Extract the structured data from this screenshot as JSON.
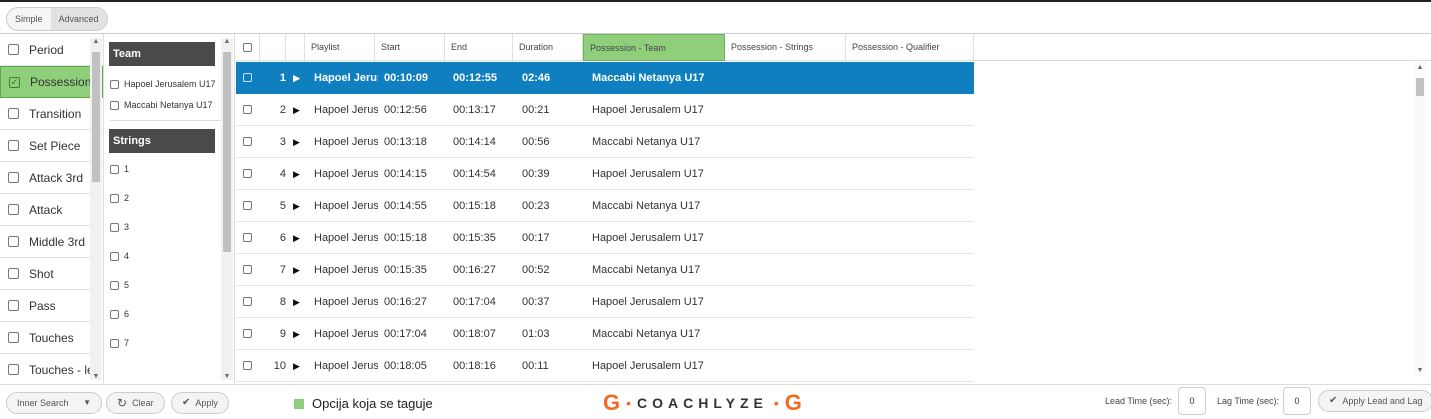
{
  "mode_toggle": {
    "simple": "Simple",
    "advanced": "Advanced"
  },
  "categories": [
    {
      "label": "Period",
      "selected": false
    },
    {
      "label": "Possession",
      "selected": true
    },
    {
      "label": "Transition",
      "selected": false
    },
    {
      "label": "Set Piece",
      "selected": false
    },
    {
      "label": "Attack 3rd",
      "selected": false
    },
    {
      "label": "Attack",
      "selected": false
    },
    {
      "label": "Middle 3rd",
      "selected": false
    },
    {
      "label": "Shot",
      "selected": false
    },
    {
      "label": "Pass",
      "selected": false
    },
    {
      "label": "Touches",
      "selected": false
    },
    {
      "label": "Touches - le",
      "selected": false
    }
  ],
  "team_filter": {
    "header": "Team",
    "options": [
      "Hapoel Jerusalem U17",
      "Maccabi Netanya U17"
    ]
  },
  "strings_filter": {
    "header": "Strings",
    "options": [
      "1",
      "2",
      "3",
      "4",
      "5",
      "6",
      "7"
    ]
  },
  "grid": {
    "headers": [
      "Playlist",
      "Start",
      "End",
      "Duration",
      "Possession - Team",
      "Possession - Strings",
      "Possession - Qualifier"
    ],
    "active_header": "Possession - Team",
    "rows": [
      {
        "num": "1",
        "playlist": "Hapoel Jerus",
        "start": "00:10:09",
        "end": "00:12:55",
        "duration": "02:46",
        "team": "Maccabi Netanya U17",
        "selected": true
      },
      {
        "num": "2",
        "playlist": "Hapoel Jerus",
        "start": "00:12:56",
        "end": "00:13:17",
        "duration": "00:21",
        "team": "Hapoel Jerusalem U17",
        "selected": false
      },
      {
        "num": "3",
        "playlist": "Hapoel Jerus",
        "start": "00:13:18",
        "end": "00:14:14",
        "duration": "00:56",
        "team": "Maccabi Netanya U17",
        "selected": false
      },
      {
        "num": "4",
        "playlist": "Hapoel Jerus",
        "start": "00:14:15",
        "end": "00:14:54",
        "duration": "00:39",
        "team": "Hapoel Jerusalem U17",
        "selected": false
      },
      {
        "num": "5",
        "playlist": "Hapoel Jerus",
        "start": "00:14:55",
        "end": "00:15:18",
        "duration": "00:23",
        "team": "Maccabi Netanya U17",
        "selected": false
      },
      {
        "num": "6",
        "playlist": "Hapoel Jerus",
        "start": "00:15:18",
        "end": "00:15:35",
        "duration": "00:17",
        "team": "Hapoel Jerusalem U17",
        "selected": false
      },
      {
        "num": "7",
        "playlist": "Hapoel Jerus",
        "start": "00:15:35",
        "end": "00:16:27",
        "duration": "00:52",
        "team": "Maccabi Netanya U17",
        "selected": false
      },
      {
        "num": "8",
        "playlist": "Hapoel Jerus",
        "start": "00:16:27",
        "end": "00:17:04",
        "duration": "00:37",
        "team": "Hapoel Jerusalem U17",
        "selected": false
      },
      {
        "num": "9",
        "playlist": "Hapoel Jerus",
        "start": "00:17:04",
        "end": "00:18:07",
        "duration": "01:03",
        "team": "Maccabi Netanya U17",
        "selected": false
      },
      {
        "num": "10",
        "playlist": "Hapoel Jerus",
        "start": "00:18:05",
        "end": "00:18:16",
        "duration": "00:11",
        "team": "Hapoel Jerusalem U17",
        "selected": false
      }
    ]
  },
  "bottom": {
    "inner_search": "Inner Search",
    "clear": "Clear",
    "apply": "Apply",
    "legend_text": "Opcija koja se taguje",
    "logo_text": "COACHLYZE",
    "lead_label": "Lead Time (sec):",
    "lead_value": "0",
    "lag_label": "Lag Time (sec):",
    "lag_value": "0",
    "apply_lead_lag": "Apply Lead and Lag"
  },
  "colors": {
    "tag_green": "#8fcf7c",
    "selected_row_blue": "#0f7fbf",
    "logo_orange": "#f26b21",
    "filter_header": "#4a4a4a"
  }
}
